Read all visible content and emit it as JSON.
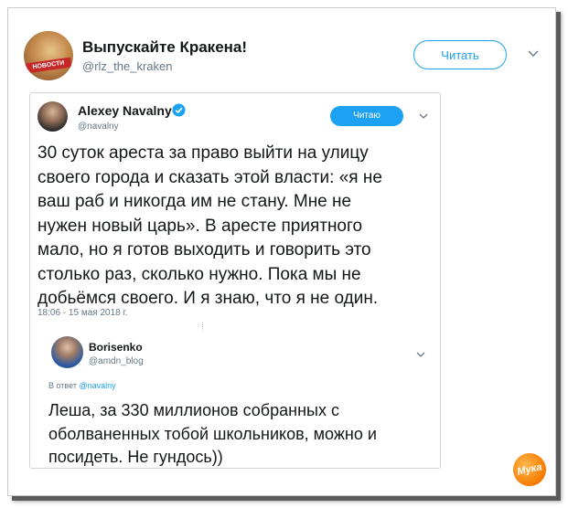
{
  "outer_tweet": {
    "name": "Выпускайте Кракена!",
    "handle": "@rlz_the_kraken",
    "follow_label": "Читать",
    "avatar_ribbon": "НОВОСТИ",
    "avatar_icon": "news-logo-icon",
    "menu_icon": "chevron-down-icon"
  },
  "quoted_tweet": {
    "name": "Alexey Navalny",
    "verified_icon": "verified-badge-icon",
    "handle": "@navalny",
    "follow_label": "Читаю",
    "text": "30 суток ареста за право выйти на улицу\nсвоего города и сказать этой власти: «я не\nваш раб и никогда им не стану. Мне не\nнужен новый царь». В аресте приятного\nмало, но я готов выходить и говорить это\nстолько раз, сколько нужно. Пока мы не\nдобьёмся своего. И я знаю, что я не один.",
    "timestamp": "18:06 - 15 мая 2018 г."
  },
  "reply": {
    "name": "Borisenko",
    "handle": "@amdn_blog",
    "reply_prefix": "В ответ",
    "reply_to": "@navalny",
    "text": "Леша, за 330 миллионов собранных с\nоболваненных тобой школьников, можно и\nпосидеть. Не гундось))"
  },
  "watermark": {
    "text": "Мука"
  },
  "colors": {
    "accent": "#1da1f2",
    "text": "#14171a",
    "muted": "#657786"
  }
}
